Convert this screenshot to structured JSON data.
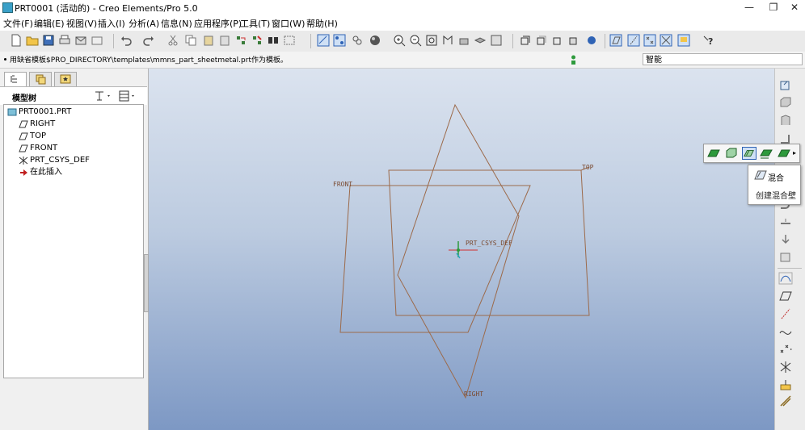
{
  "window": {
    "title": "PRT0001 (活动的) - Creo Elements/Pro 5.0",
    "controls": [
      "minimize-icon",
      "restore-icon",
      "close-icon"
    ]
  },
  "menu": [
    "文件(F)",
    "编辑(E)",
    "视图(V)",
    "插入(I)",
    "分析(A)",
    "信息(N)",
    "应用程序(P)",
    "工具(T)",
    "窗口(W)",
    "帮助(H)"
  ],
  "message": {
    "text": "用缺省模板$PRO_DIRECTORY\\templates\\mmns_part_sheetmetal.prt作为模板。"
  },
  "smart_filter": {
    "value": "智能"
  },
  "left_panel": {
    "tabs": [
      "model-tree-tab-icon",
      "layer-tree-tab-icon",
      "favorites-tab-icon"
    ],
    "header": "模型树",
    "tree": [
      {
        "label": "PRT0001.PRT",
        "icon": "part-icon"
      },
      {
        "label": "RIGHT",
        "icon": "datum-plane-icon"
      },
      {
        "label": "TOP",
        "icon": "datum-plane-icon"
      },
      {
        "label": "FRONT",
        "icon": "datum-plane-icon"
      },
      {
        "label": "PRT_CSYS_DEF",
        "icon": "csys-icon"
      },
      {
        "label": "在此插入",
        "icon": "insert-here-arrow-icon"
      }
    ]
  },
  "graphics": {
    "labels": {
      "front": "FRONT",
      "top": "TOP",
      "right": "RIGHT",
      "csys": "PRT_CSYS_DEF"
    }
  },
  "tooltip": {
    "title": "混合",
    "subtitle": "创建混合壁"
  },
  "colors": {
    "datum": "#9c6a4a",
    "accent": "#2f63b5",
    "sheet_green": "#2e9a3c"
  }
}
